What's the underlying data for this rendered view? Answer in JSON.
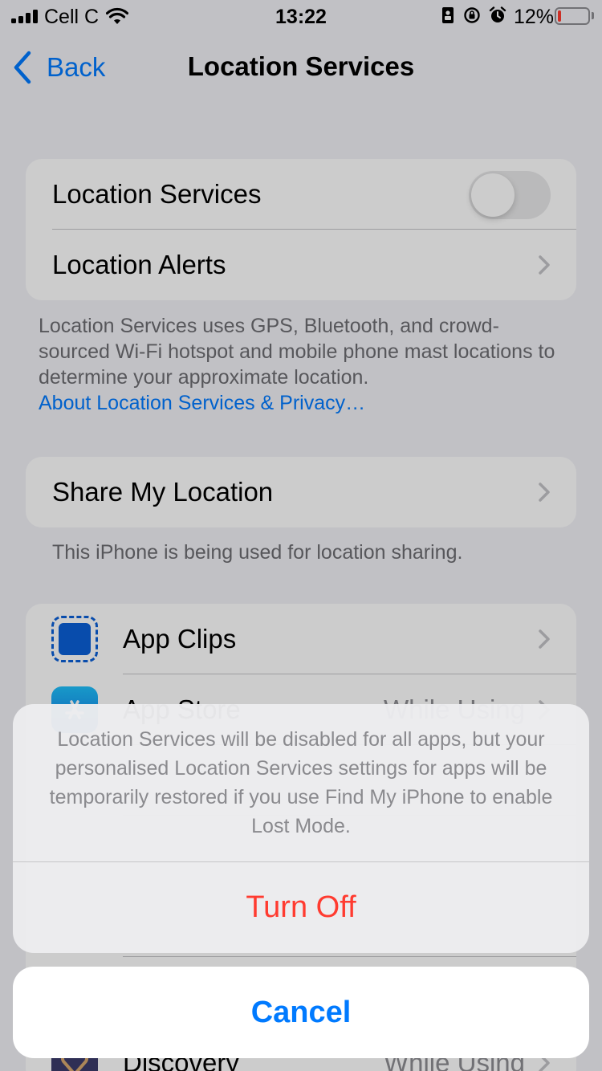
{
  "status_bar": {
    "carrier": "Cell C",
    "time": "13:22",
    "battery_percent": "12%",
    "battery_level": 0.12
  },
  "nav": {
    "back_label": "Back",
    "title": "Location Services"
  },
  "location_group": {
    "location_services_label": "Location Services",
    "location_services_enabled": false,
    "location_alerts_label": "Location Alerts"
  },
  "location_footer": {
    "text": "Location Services uses GPS, Bluetooth, and crowd-sourced Wi-Fi hotspot and mobile phone mast locations to determine your approximate location.",
    "link": "About Location Services & Privacy…"
  },
  "share_group": {
    "label": "Share My Location",
    "footer": "This iPhone is being used for location sharing."
  },
  "apps": [
    {
      "name": "App Clips",
      "value": "",
      "icon": "app-clips-icon"
    },
    {
      "name": "App Store",
      "value": "While Using",
      "icon": "app-store-icon"
    },
    {
      "name": "Discovery",
      "value": "While Using",
      "icon": "discovery-icon"
    }
  ],
  "action_sheet": {
    "message": "Location Services will be disabled for all apps, but your personalised Location Services settings for apps will be temporarily restored if you use Find My iPhone to enable Lost Mode.",
    "turn_off_label": "Turn Off",
    "cancel_label": "Cancel"
  },
  "colors": {
    "accent": "#007aff",
    "destructive": "#ff3b30",
    "background": "#f2f2f7"
  }
}
